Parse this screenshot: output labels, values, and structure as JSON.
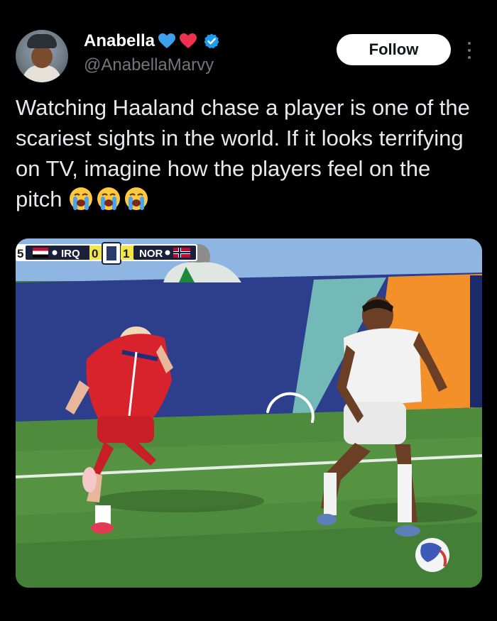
{
  "author": {
    "display_name": "Anabella",
    "handle": "@AnabellaMarvy",
    "verified": true,
    "avatar_icon": "avatar-photo",
    "name_emojis": [
      "blue-heart-icon",
      "red-heart-icon"
    ]
  },
  "actions": {
    "follow_label": "Follow",
    "more_icon": "more-vertical-icon"
  },
  "tweet": {
    "text": "Watching Haaland chase a player is one of the scariest sights in the world. If it looks terrifying on TV, imagine how the players feel on the pitch",
    "trailing_emojis": [
      "loudly-crying-face",
      "loudly-crying-face",
      "loudly-crying-face"
    ]
  },
  "media": {
    "type": "video-still",
    "scoreboard": {
      "left_digit": "5",
      "home_team": "IRQ",
      "home_score": "0",
      "away_score": "1",
      "away_team": "NOR"
    },
    "loading_indicator": "spinner-icon"
  },
  "colors": {
    "background": "#000000",
    "text": "#e7e9ea",
    "secondary_text": "#71767b",
    "verified_blue": "#1d9bf0",
    "follow_button_bg": "#ffffff"
  }
}
